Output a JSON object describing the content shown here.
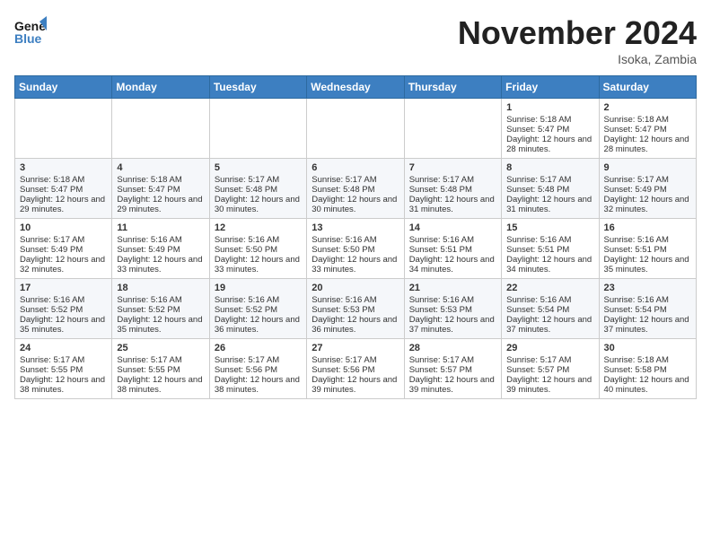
{
  "header": {
    "logo_line1": "General",
    "logo_line2": "Blue",
    "month": "November 2024",
    "location": "Isoka, Zambia"
  },
  "weekdays": [
    "Sunday",
    "Monday",
    "Tuesday",
    "Wednesday",
    "Thursday",
    "Friday",
    "Saturday"
  ],
  "weeks": [
    [
      {
        "day": "",
        "info": ""
      },
      {
        "day": "",
        "info": ""
      },
      {
        "day": "",
        "info": ""
      },
      {
        "day": "",
        "info": ""
      },
      {
        "day": "",
        "info": ""
      },
      {
        "day": "1",
        "info": "Sunrise: 5:18 AM\nSunset: 5:47 PM\nDaylight: 12 hours and 28 minutes."
      },
      {
        "day": "2",
        "info": "Sunrise: 5:18 AM\nSunset: 5:47 PM\nDaylight: 12 hours and 28 minutes."
      }
    ],
    [
      {
        "day": "3",
        "info": "Sunrise: 5:18 AM\nSunset: 5:47 PM\nDaylight: 12 hours and 29 minutes."
      },
      {
        "day": "4",
        "info": "Sunrise: 5:18 AM\nSunset: 5:47 PM\nDaylight: 12 hours and 29 minutes."
      },
      {
        "day": "5",
        "info": "Sunrise: 5:17 AM\nSunset: 5:48 PM\nDaylight: 12 hours and 30 minutes."
      },
      {
        "day": "6",
        "info": "Sunrise: 5:17 AM\nSunset: 5:48 PM\nDaylight: 12 hours and 30 minutes."
      },
      {
        "day": "7",
        "info": "Sunrise: 5:17 AM\nSunset: 5:48 PM\nDaylight: 12 hours and 31 minutes."
      },
      {
        "day": "8",
        "info": "Sunrise: 5:17 AM\nSunset: 5:48 PM\nDaylight: 12 hours and 31 minutes."
      },
      {
        "day": "9",
        "info": "Sunrise: 5:17 AM\nSunset: 5:49 PM\nDaylight: 12 hours and 32 minutes."
      }
    ],
    [
      {
        "day": "10",
        "info": "Sunrise: 5:17 AM\nSunset: 5:49 PM\nDaylight: 12 hours and 32 minutes."
      },
      {
        "day": "11",
        "info": "Sunrise: 5:16 AM\nSunset: 5:49 PM\nDaylight: 12 hours and 33 minutes."
      },
      {
        "day": "12",
        "info": "Sunrise: 5:16 AM\nSunset: 5:50 PM\nDaylight: 12 hours and 33 minutes."
      },
      {
        "day": "13",
        "info": "Sunrise: 5:16 AM\nSunset: 5:50 PM\nDaylight: 12 hours and 33 minutes."
      },
      {
        "day": "14",
        "info": "Sunrise: 5:16 AM\nSunset: 5:51 PM\nDaylight: 12 hours and 34 minutes."
      },
      {
        "day": "15",
        "info": "Sunrise: 5:16 AM\nSunset: 5:51 PM\nDaylight: 12 hours and 34 minutes."
      },
      {
        "day": "16",
        "info": "Sunrise: 5:16 AM\nSunset: 5:51 PM\nDaylight: 12 hours and 35 minutes."
      }
    ],
    [
      {
        "day": "17",
        "info": "Sunrise: 5:16 AM\nSunset: 5:52 PM\nDaylight: 12 hours and 35 minutes."
      },
      {
        "day": "18",
        "info": "Sunrise: 5:16 AM\nSunset: 5:52 PM\nDaylight: 12 hours and 35 minutes."
      },
      {
        "day": "19",
        "info": "Sunrise: 5:16 AM\nSunset: 5:52 PM\nDaylight: 12 hours and 36 minutes."
      },
      {
        "day": "20",
        "info": "Sunrise: 5:16 AM\nSunset: 5:53 PM\nDaylight: 12 hours and 36 minutes."
      },
      {
        "day": "21",
        "info": "Sunrise: 5:16 AM\nSunset: 5:53 PM\nDaylight: 12 hours and 37 minutes."
      },
      {
        "day": "22",
        "info": "Sunrise: 5:16 AM\nSunset: 5:54 PM\nDaylight: 12 hours and 37 minutes."
      },
      {
        "day": "23",
        "info": "Sunrise: 5:16 AM\nSunset: 5:54 PM\nDaylight: 12 hours and 37 minutes."
      }
    ],
    [
      {
        "day": "24",
        "info": "Sunrise: 5:17 AM\nSunset: 5:55 PM\nDaylight: 12 hours and 38 minutes."
      },
      {
        "day": "25",
        "info": "Sunrise: 5:17 AM\nSunset: 5:55 PM\nDaylight: 12 hours and 38 minutes."
      },
      {
        "day": "26",
        "info": "Sunrise: 5:17 AM\nSunset: 5:56 PM\nDaylight: 12 hours and 38 minutes."
      },
      {
        "day": "27",
        "info": "Sunrise: 5:17 AM\nSunset: 5:56 PM\nDaylight: 12 hours and 39 minutes."
      },
      {
        "day": "28",
        "info": "Sunrise: 5:17 AM\nSunset: 5:57 PM\nDaylight: 12 hours and 39 minutes."
      },
      {
        "day": "29",
        "info": "Sunrise: 5:17 AM\nSunset: 5:57 PM\nDaylight: 12 hours and 39 minutes."
      },
      {
        "day": "30",
        "info": "Sunrise: 5:18 AM\nSunset: 5:58 PM\nDaylight: 12 hours and 40 minutes."
      }
    ]
  ]
}
